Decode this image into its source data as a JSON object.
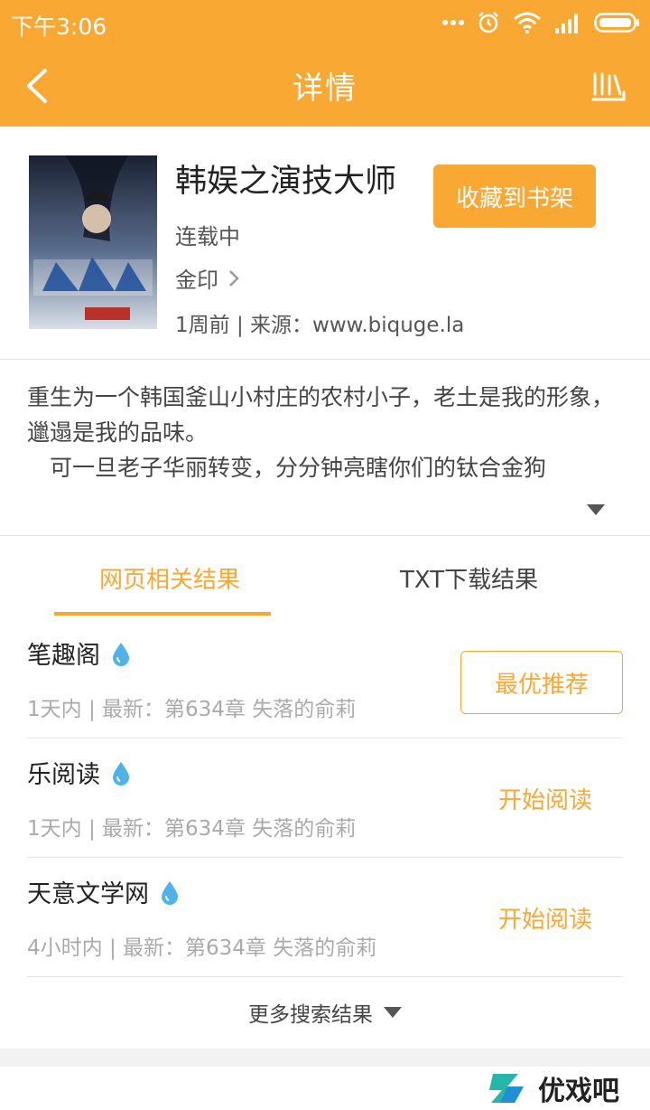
{
  "status_bar": {
    "time": "下午3:06"
  },
  "nav": {
    "title": "详情"
  },
  "book": {
    "title": "韩娱之演技大师",
    "status": "连载中",
    "author": "金印",
    "meta": "1周前 | 来源：www.biquge.la",
    "favorite_label": "收藏到书架"
  },
  "synopsis": {
    "text": "重生为一个韩国釜山小村庄的农村小子，老土是我的形象，邋遢是我的品味。\n　可一旦老子华丽转变，分分钟亮瞎你们的钛合金狗"
  },
  "tabs": [
    {
      "label": "网页相关结果",
      "active": true
    },
    {
      "label": "TXT下载结果",
      "active": false
    }
  ],
  "sources": [
    {
      "name": "笔趣阁",
      "latest": "1天内 | 最新：第634章 失落的俞莉",
      "action": "最优推荐"
    },
    {
      "name": "乐阅读",
      "latest": "1天内 | 最新：第634章 失落的俞莉",
      "action": "开始阅读"
    },
    {
      "name": "天意文学网",
      "latest": "4小时内 | 最新：第634章 失落的俞莉",
      "action": "开始阅读"
    }
  ],
  "more_results": "更多搜索结果",
  "watermark": "优戏吧",
  "colors": {
    "accent": "#f9a833",
    "drop_icon": "#4fb3e8"
  }
}
